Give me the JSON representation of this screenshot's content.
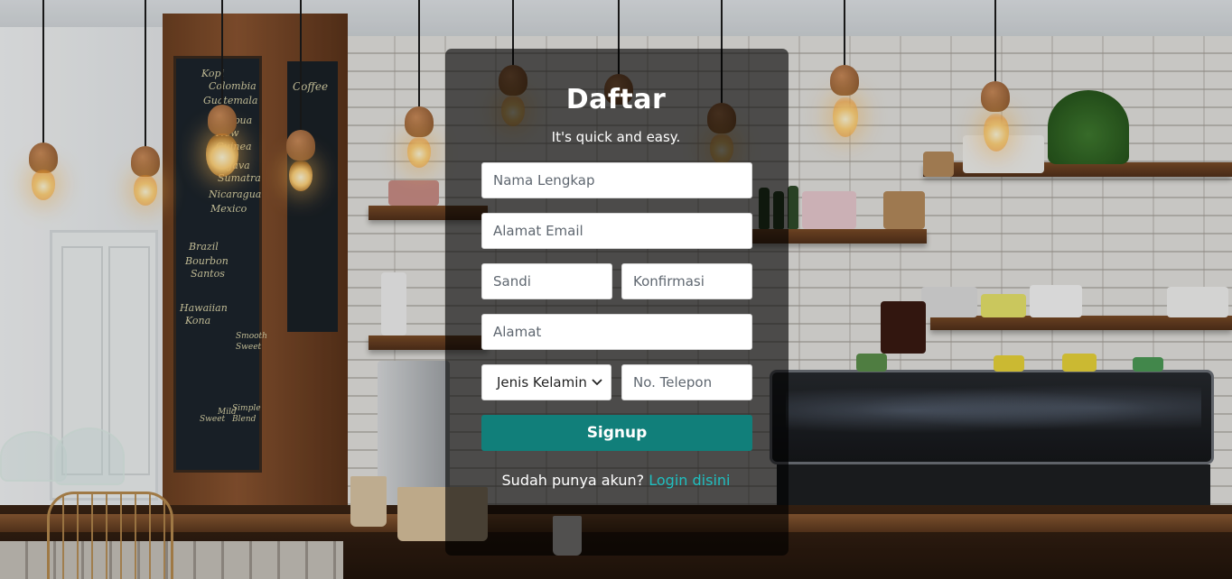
{
  "form": {
    "title": "Daftar",
    "subtitle": "It's quick and easy.",
    "fields": {
      "full_name_placeholder": "Nama Lengkap",
      "email_placeholder": "Alamat Email",
      "password_placeholder": "Sandi",
      "confirm_placeholder": "Konfirmasi",
      "address_placeholder": "Alamat",
      "gender_selected": "Jenis Kelamin",
      "phone_placeholder": "No. Telepon"
    },
    "signup_label": "Signup",
    "login_prompt": "Sudah punya akun?",
    "login_link": "Login disini"
  },
  "background": {
    "chalkboard_text": [
      "Kopi",
      "Colombia",
      "Guatemala",
      "Papua",
      "New Guinea",
      "Java",
      "Sumatra",
      "Nicaragua",
      "Mexico",
      "Brazil",
      "Bourbon",
      "Santos",
      "Hawaiian",
      "Kona",
      "Smooth",
      "Sweet",
      "Sweet",
      "Mild",
      "Simple",
      "Blend",
      "Coffee"
    ]
  },
  "colors": {
    "accent": "#117f7a",
    "link": "#1fbfc0",
    "card_bg": "rgba(0,0,0,0.62)"
  },
  "icons": {
    "select_arrow": "chevron-down-icon"
  }
}
